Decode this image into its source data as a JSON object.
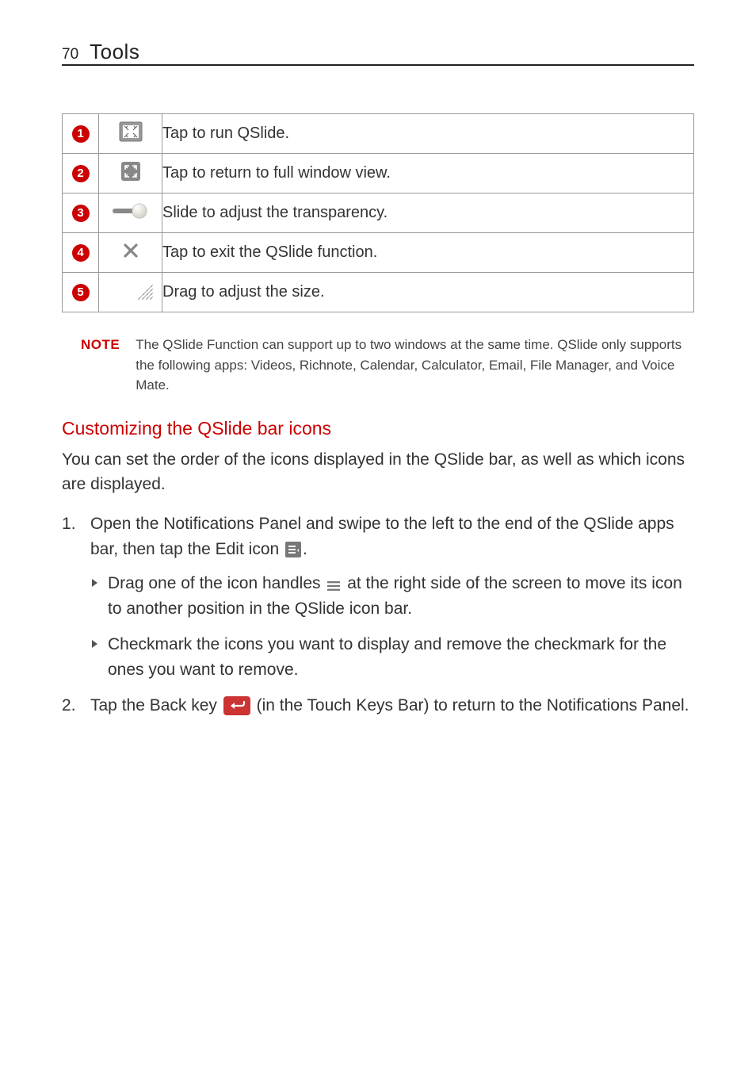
{
  "header": {
    "page_number": "70",
    "section": "Tools"
  },
  "table": {
    "rows": [
      {
        "num": "1",
        "desc": "Tap to run QSlide."
      },
      {
        "num": "2",
        "desc": "Tap to return to full window view."
      },
      {
        "num": "3",
        "desc": "Slide to adjust the transparency."
      },
      {
        "num": "4",
        "desc": "Tap to exit the QSlide function."
      },
      {
        "num": "5",
        "desc": "Drag to adjust the size."
      }
    ]
  },
  "note": {
    "label": "NOTE",
    "text": "The QSlide Function can support up to two windows at the same time. QSlide only supports the following apps: Videos, Richnote, Calendar, Calculator, Email, File Manager, and Voice Mate."
  },
  "heading": "Customizing the QSlide bar icons",
  "intro": "You can set the order of the icons displayed in the QSlide bar, as well as which icons are displayed.",
  "steps": {
    "s1_a": "Open the Notifications Panel and swipe to the left to the end of the QSlide apps bar, then tap the ",
    "s1_edit": "Edit",
    "s1_b": " icon ",
    "s1_c": ".",
    "s1_sub1_a": "Drag one of the icon handles ",
    "s1_sub1_b": " at the right side of the screen to move its icon to another position in the QSlide icon bar.",
    "s1_sub2": "Checkmark the icons you want to display and remove the checkmark for the ones you want to remove.",
    "s2_a": "Tap the ",
    "s2_backkey": "Back key",
    "s2_b": " ",
    "s2_c": " (in the Touch Keys Bar) to return to the Notifications Panel."
  }
}
